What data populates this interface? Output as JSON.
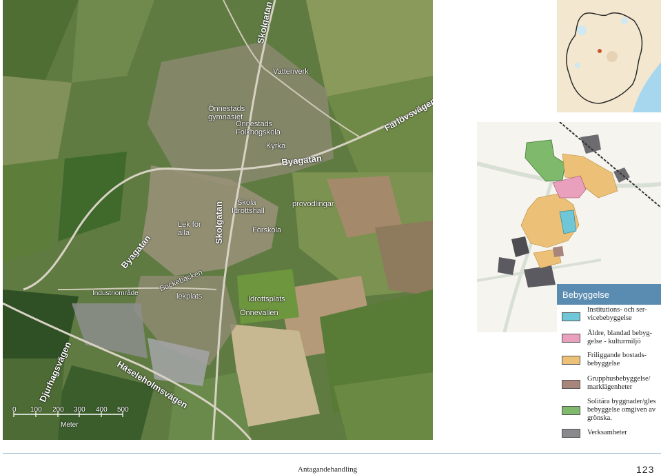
{
  "aerial_map": {
    "road_labels": {
      "skolgatan_north": "Skolgatan",
      "skolgatan_mid": "Skolgatan",
      "farlovsvagen": "Färlövsvägen",
      "byagatan_east": "Byagatan",
      "byagatan_west": "Byagatan",
      "djurhagsvagen": "Djurhagsvägen",
      "haseleholmsvagen": "Häseleholmsvägen"
    },
    "place_labels": {
      "vattenverk": "Vattenverk",
      "gymnasiet": "Önnestads\ngymnasiet",
      "folkhogskola": "Önnestads\nFolkhögskola",
      "kyrka": "Kyrka",
      "skola": "Skola",
      "idrottshall": "Idrottshall",
      "forskola": "Förskola",
      "provodlingar": "provodlingar",
      "lek_for_alla": "Lek för\nalla",
      "bockebacken": "Bockebäcken",
      "lekplats": "lekplats",
      "industriomrade": "Industriområde",
      "idrottsplats": "Idrottsplats",
      "onnevallen": "Önnevallen"
    },
    "scale_bar": {
      "ticks": [
        "0",
        "100",
        "200",
        "300",
        "400",
        "500"
      ],
      "unit": "Meter"
    }
  },
  "legend": {
    "title": "Bebyggelse",
    "items": [
      {
        "label": "Institutions- och ser-\nvicebebyggelse",
        "color": "#6fc6d6"
      },
      {
        "label": "Äldre, blandad bebyg-\ngelse - kulturmiljö",
        "color": "#e9a0bd"
      },
      {
        "label": "Friliggande bostads-\nbebyggelse",
        "color": "#ecc077"
      },
      {
        "label": "Grupphusbebyggelse/\nmarklägenheter",
        "color": "#a8857a"
      },
      {
        "label": "Solitära byggnader/gles\nbebyggelse omgiven av\ngrönska.",
        "color": "#7fba6c"
      },
      {
        "label": "Verksamheter",
        "color": "#8a8a8e"
      }
    ]
  },
  "colors": {
    "legend_header_bg": "#5a8bb0",
    "water": "#a7d7ee",
    "rail": "#333333"
  },
  "footer": {
    "label": "Antagandehandling",
    "page_number": "123"
  }
}
